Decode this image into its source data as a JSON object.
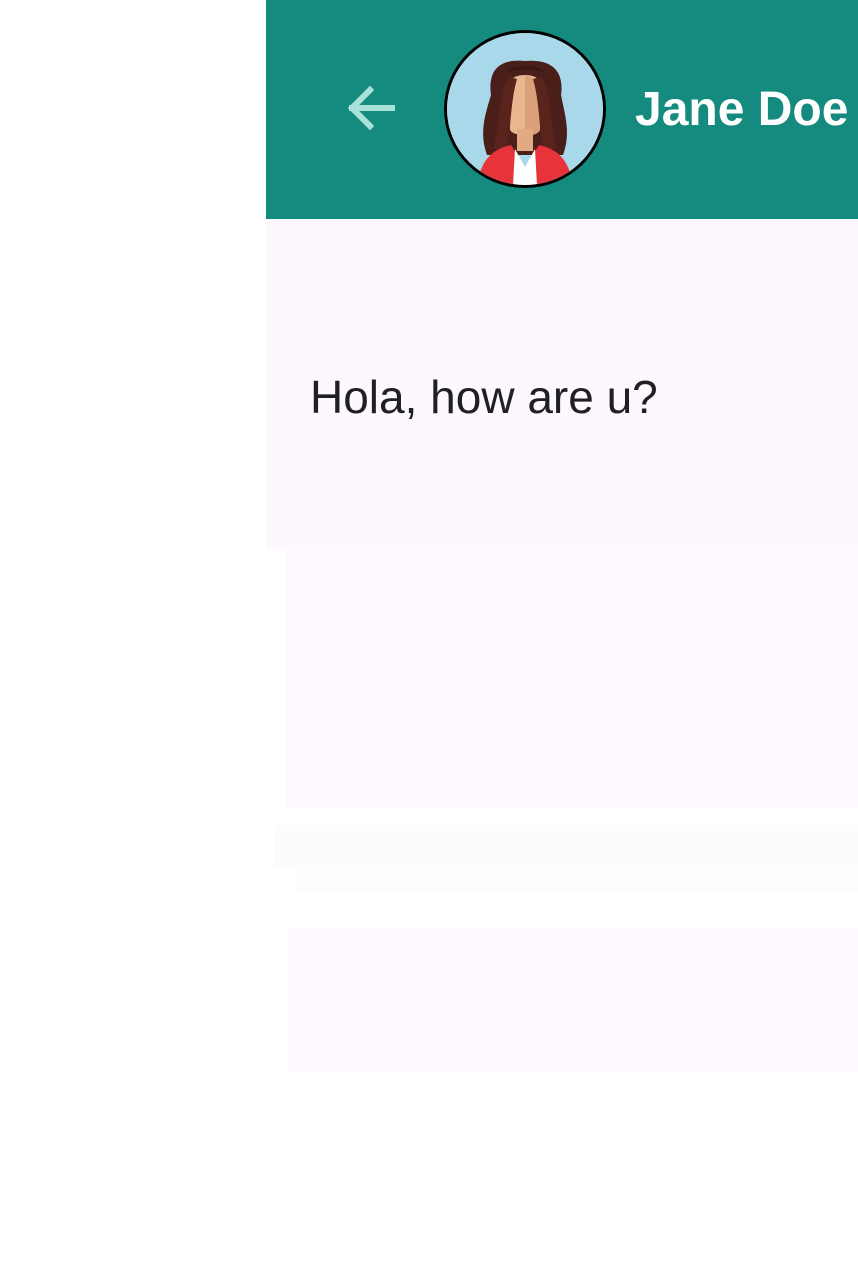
{
  "header": {
    "back_icon": "arrow-left-icon",
    "avatar_icon": "woman-avatar-icon",
    "contact_name": "Jane Doe"
  },
  "conversation": {
    "messages": [
      {
        "text": "Hola, how are u?"
      }
    ]
  },
  "colors": {
    "app_bar": "#158a7e",
    "back_arrow": "#a9e2d8",
    "message_background": "#fcf8fd",
    "message_text": "#1f1f24"
  }
}
